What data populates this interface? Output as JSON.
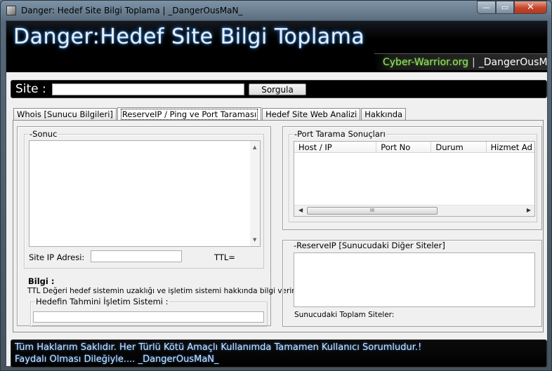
{
  "window": {
    "title": "Danger: Hedef Site Bilgi Toplama | _DangerOusMaN_",
    "controls": {
      "minimize": "—",
      "maximize": "▭",
      "close": "✕"
    }
  },
  "banner": {
    "title": "Danger:Hedef Site Bilgi Toplama",
    "site": "Cyber-Warrior.org",
    "separator": "|",
    "author": "_DangerOusMaN_"
  },
  "site_bar": {
    "label": "Site :",
    "input_value": "",
    "query_button": "Sorgula"
  },
  "tabs": [
    {
      "label": "Whois [Sunucu Bilgileri]",
      "active": false
    },
    {
      "label": "ReserveIP / Ping ve Port Taraması",
      "active": true
    },
    {
      "label": "Hedef Site Web Analizi",
      "active": false
    },
    {
      "label": "Hakkında",
      "active": false
    }
  ],
  "left": {
    "result_group": "-Sonuc",
    "result_text": "",
    "site_ip_label": "Site IP Adresi:",
    "site_ip_value": "",
    "ttl_label": "TTL=",
    "info_title": "Bilgi :",
    "info_text": "TTL Değeri hedef sistemin uzaklığı ve işletim sistemi  hakkında bilgi verir.",
    "os_group": "Hedefin Tahmini İşletim Sistemi :",
    "os_value": ""
  },
  "port_scan": {
    "group": "-Port Tarama Sonuçları",
    "columns": [
      "Host / IP",
      "Port No",
      "Durum",
      "Hizmet Ad"
    ],
    "rows": [],
    "scroll_thumb": "III"
  },
  "reserve_ip": {
    "group": "-ReserveIP [Sunucudaki Diğer Siteler]",
    "list": "",
    "total_label": "Sunucudaki Toplam Siteler:"
  },
  "footer": {
    "line1": "Tüm Haklarım Saklıdır. Her Türlü Kötü Amaçlı Kullanımda Tamamen Kullanıcı Sorumludur.!",
    "line2": "Faydalı Olması Dileğiyle.... _DangerOusMaN_"
  }
}
